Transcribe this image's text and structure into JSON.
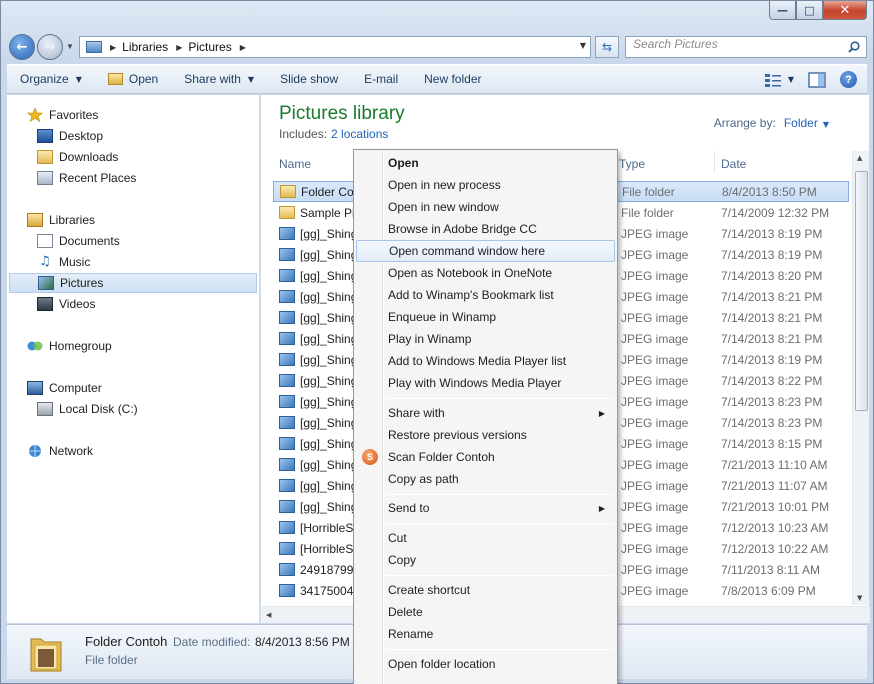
{
  "address": {
    "crumbs": [
      "Libraries",
      "Pictures"
    ]
  },
  "search": {
    "placeholder": "Search Pictures"
  },
  "toolbar": {
    "organize": "Organize",
    "open": "Open",
    "share_with": "Share with",
    "slide_show": "Slide show",
    "email": "E-mail",
    "new_folder": "New folder"
  },
  "navpane": {
    "favorites": "Favorites",
    "desktop": "Desktop",
    "downloads": "Downloads",
    "recent_places": "Recent Places",
    "libraries": "Libraries",
    "documents": "Documents",
    "music": "Music",
    "pictures": "Pictures",
    "videos": "Videos",
    "homegroup": "Homegroup",
    "computer": "Computer",
    "local_disk": "Local Disk (C:)",
    "network": "Network"
  },
  "main": {
    "title": "Pictures library",
    "includes_label": "Includes:",
    "includes_link": "2 locations",
    "arrange_label": "Arrange by:",
    "arrange_value": "Folder",
    "columns": {
      "name": "Name",
      "type": "Type",
      "date": "Date"
    }
  },
  "files": [
    {
      "name": "Folder Contoh",
      "type": "File folder",
      "date": "8/4/2013 8:50 PM",
      "kind": "folder"
    },
    {
      "name": "Sample Pictures",
      "type": "File folder",
      "date": "7/14/2009 12:32 PM",
      "kind": "folder"
    },
    {
      "name": "[gg]_Shingeki",
      "type": "JPEG image",
      "date": "7/14/2013 8:19 PM",
      "kind": "img"
    },
    {
      "name": "[gg]_Shingeki",
      "type": "JPEG image",
      "date": "7/14/2013 8:19 PM",
      "kind": "img"
    },
    {
      "name": "[gg]_Shingeki",
      "type": "JPEG image",
      "date": "7/14/2013 8:20 PM",
      "kind": "img"
    },
    {
      "name": "[gg]_Shingeki",
      "type": "JPEG image",
      "date": "7/14/2013 8:21 PM",
      "kind": "img"
    },
    {
      "name": "[gg]_Shingeki",
      "type": "JPEG image",
      "date": "7/14/2013 8:21 PM",
      "kind": "img"
    },
    {
      "name": "[gg]_Shingeki",
      "type": "JPEG image",
      "date": "7/14/2013 8:21 PM",
      "kind": "img"
    },
    {
      "name": "[gg]_Shingeki",
      "type": "JPEG image",
      "date": "7/14/2013 8:19 PM",
      "kind": "img"
    },
    {
      "name": "[gg]_Shingeki",
      "type": "JPEG image",
      "date": "7/14/2013 8:22 PM",
      "kind": "img"
    },
    {
      "name": "[gg]_Shingeki",
      "type": "JPEG image",
      "date": "7/14/2013 8:23 PM",
      "kind": "img"
    },
    {
      "name": "[gg]_Shingeki",
      "type": "JPEG image",
      "date": "7/14/2013 8:23 PM",
      "kind": "img"
    },
    {
      "name": "[gg]_Shingeki",
      "type": "JPEG image",
      "date": "7/14/2013 8:15 PM",
      "kind": "img"
    },
    {
      "name": "[gg]_Shingeki",
      "type": "JPEG image",
      "date": "7/21/2013 11:10 AM",
      "kind": "img"
    },
    {
      "name": "[gg]_Shingeki",
      "type": "JPEG image",
      "date": "7/21/2013 11:07 AM",
      "kind": "img"
    },
    {
      "name": "[gg]_Shingeki",
      "type": "JPEG image",
      "date": "7/21/2013 10:01 PM",
      "kind": "img"
    },
    {
      "name": "[HorribleSubs]",
      "type": "JPEG image",
      "date": "7/12/2013 10:23 AM",
      "kind": "img"
    },
    {
      "name": "[HorribleSubs]",
      "type": "JPEG image",
      "date": "7/12/2013 10:22 AM",
      "kind": "img"
    },
    {
      "name": "24918799_",
      "type": "JPEG image",
      "date": "7/11/2013 8:11 AM",
      "kind": "img"
    },
    {
      "name": "34175004",
      "type": "JPEG image",
      "date": "7/8/2013 6:09 PM",
      "kind": "img"
    }
  ],
  "details": {
    "name": "Folder Contoh",
    "modified_label": "Date modified:",
    "modified_value": "8/4/2013 8:56 PM",
    "type": "File folder"
  },
  "context_menu": {
    "open": "Open",
    "open_new_process": "Open in new process",
    "open_new_window": "Open in new window",
    "browse_bridge": "Browse in Adobe Bridge CC",
    "open_cmd": "Open command window here",
    "open_onenote": "Open as Notebook in OneNote",
    "winamp_bookmark": "Add to Winamp's Bookmark list",
    "enqueue_winamp": "Enqueue in Winamp",
    "play_winamp": "Play in Winamp",
    "add_wmp": "Add to Windows Media Player list",
    "play_wmp": "Play with Windows Media Player",
    "share_with": "Share with",
    "restore": "Restore previous versions",
    "scan": "Scan Folder Contoh",
    "copy_path": "Copy as path",
    "send_to": "Send to",
    "cut": "Cut",
    "copy": "Copy",
    "create_shortcut": "Create shortcut",
    "delete": "Delete",
    "rename": "Rename",
    "open_location": "Open folder location"
  }
}
